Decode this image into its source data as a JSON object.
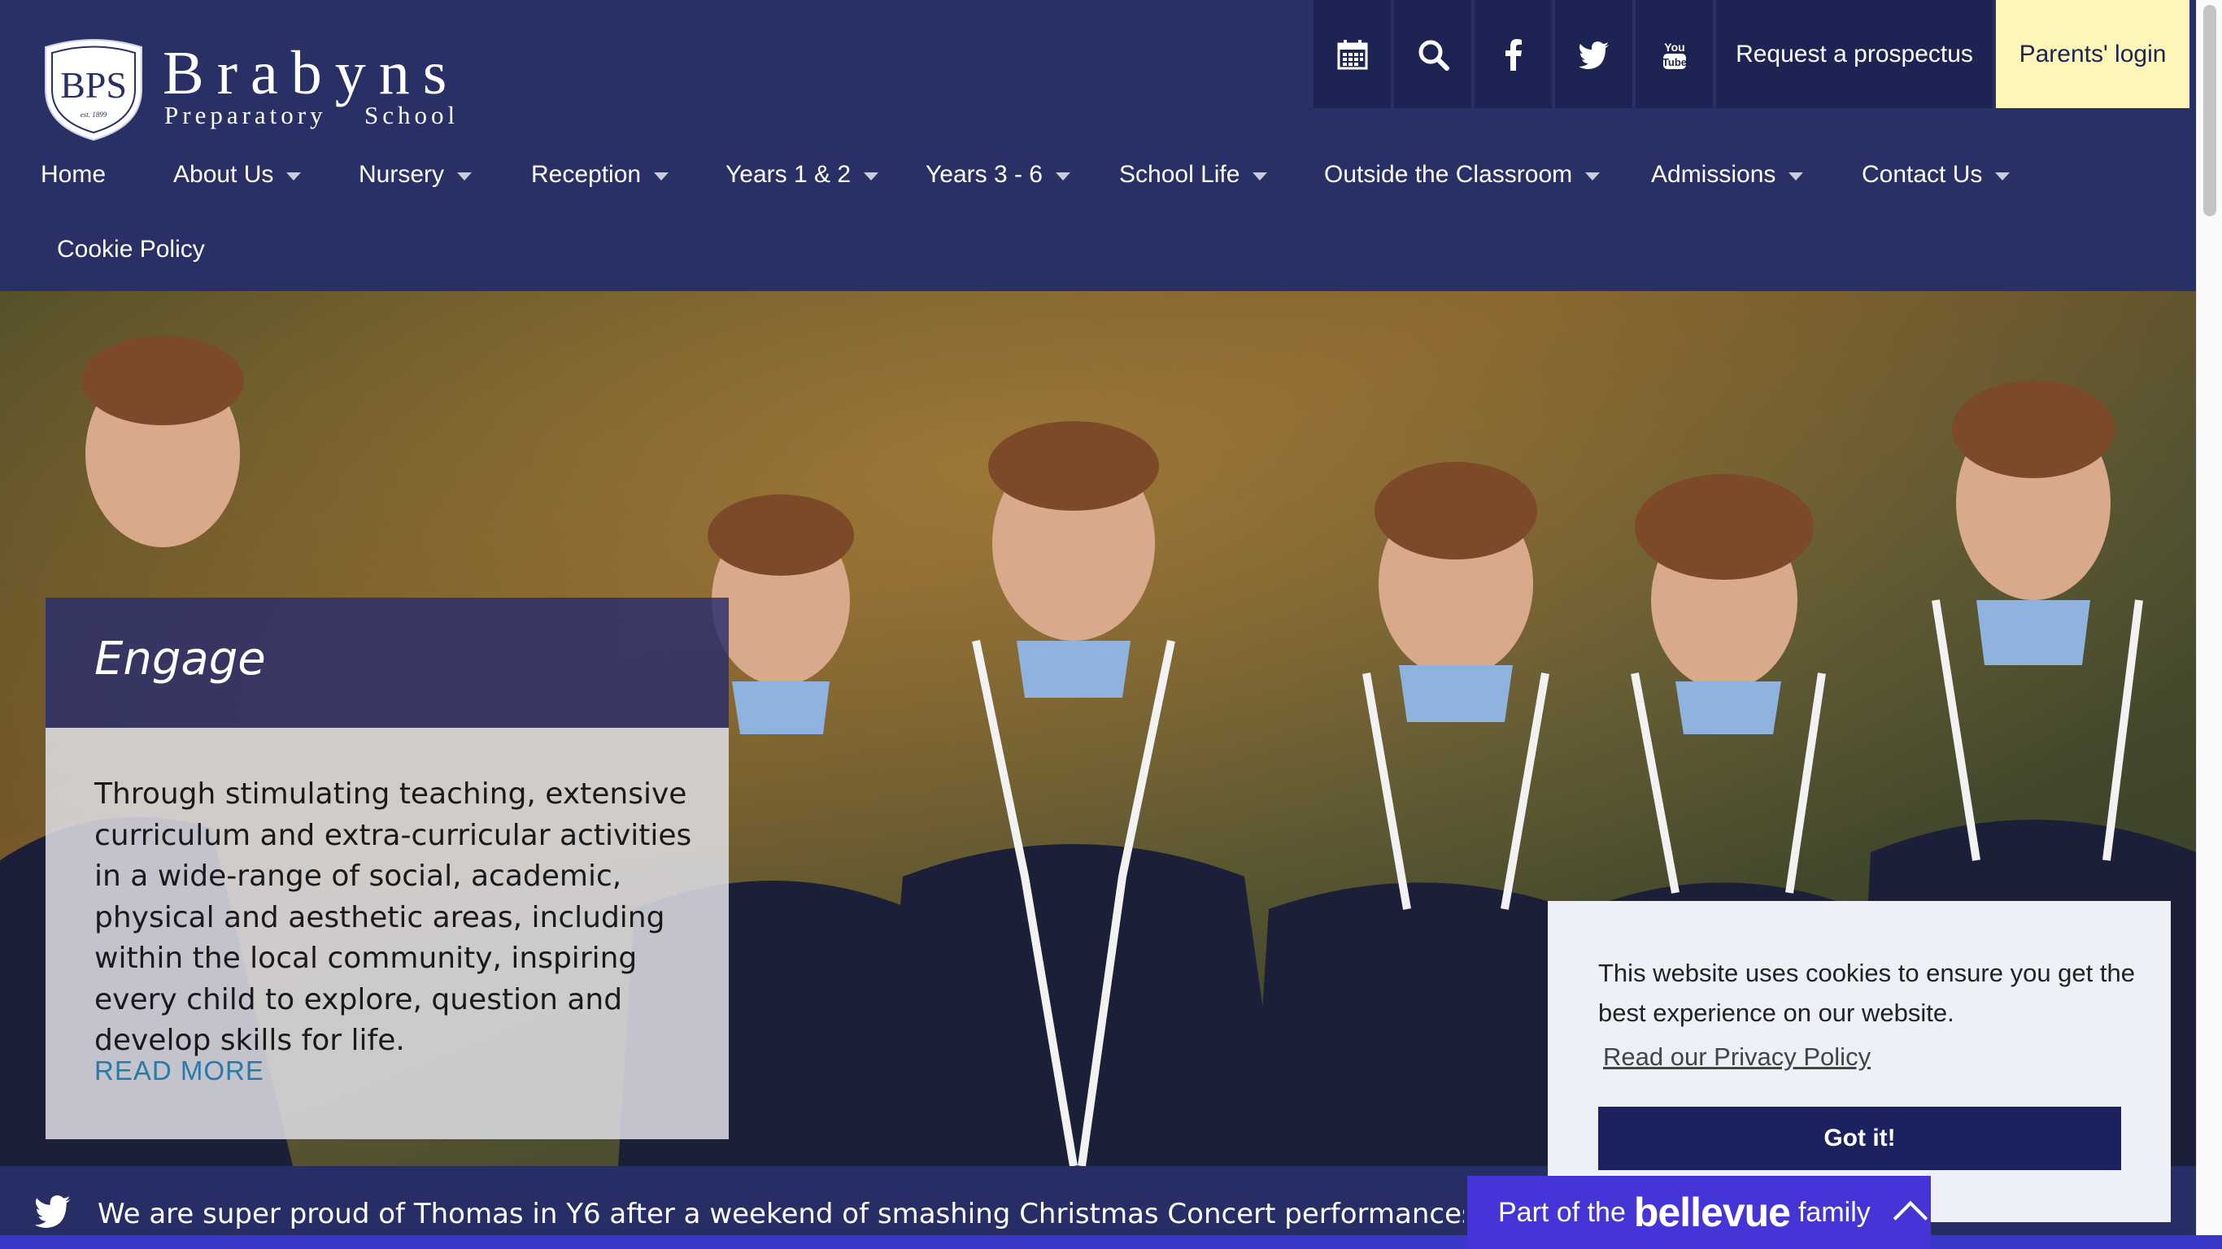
{
  "logo": {
    "monogram": "BPS",
    "name": "Brabyns",
    "subtitle1": "Preparatory",
    "subtitle2": "School",
    "est": "est. 1899"
  },
  "topbar": {
    "icons": [
      "calendar-icon",
      "search-icon",
      "facebook-icon",
      "twitter-icon",
      "youtube-icon"
    ],
    "prospectus": "Request a prospectus",
    "parents_login": "Parents' login"
  },
  "nav": {
    "items": [
      {
        "label": "Home",
        "dropdown": false
      },
      {
        "label": "About Us",
        "dropdown": true
      },
      {
        "label": "Nursery",
        "dropdown": true
      },
      {
        "label": "Reception",
        "dropdown": true
      },
      {
        "label": "Years 1 & 2",
        "dropdown": true
      },
      {
        "label": "Years 3 - 6",
        "dropdown": true
      },
      {
        "label": "School Life",
        "dropdown": true
      },
      {
        "label": "Outside the Classroom",
        "dropdown": true
      },
      {
        "label": "Admissions",
        "dropdown": true
      },
      {
        "label": "Contact Us",
        "dropdown": true
      },
      {
        "label": "Cookie Policy",
        "dropdown": false
      }
    ]
  },
  "hero": {
    "title": "Engage",
    "body": "Through stimulating teaching, extensive curriculum and extra-curricular activities in a wide-range of social, academic, physical and aesthetic areas, including within the local community, inspiring every child to explore, question and develop skills for life.",
    "read_more": "READ MORE"
  },
  "twitter": {
    "text": "We are super proud of Thomas in Y6 after a weekend of smashing Christmas Concert performances with the Hallé"
  },
  "cookie": {
    "message": "This website uses cookies to ensure you get the best experience on our website.",
    "link": "Read our Privacy Policy",
    "button": "Got it!"
  },
  "bellevue": {
    "prefix": "Part of the",
    "brand": "bellevue",
    "suffix": "family"
  },
  "colors": {
    "navy": "#283066",
    "parents_bg": "#fdf6b8",
    "bellevue": "#4535d6",
    "cookie_button": "#1c2160",
    "read_more": "#2a7aa8"
  }
}
